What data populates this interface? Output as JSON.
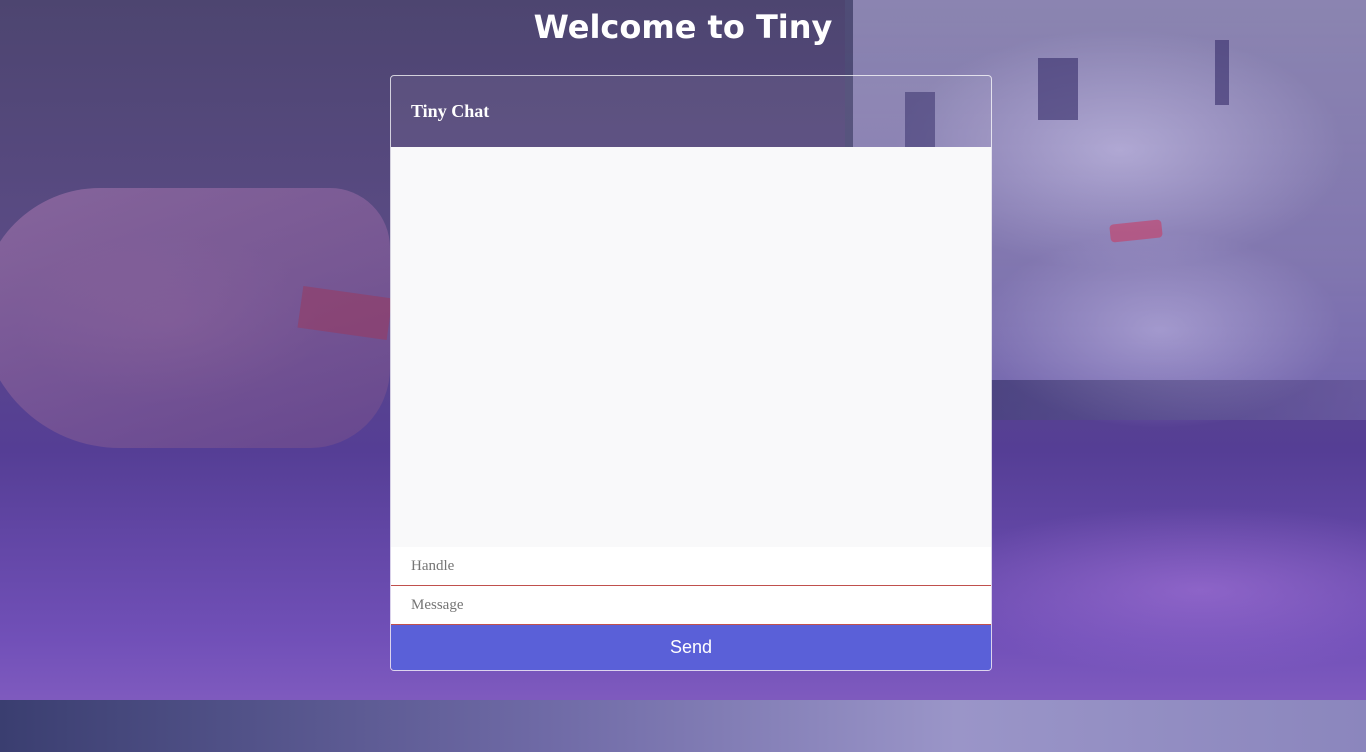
{
  "page": {
    "title": "Welcome to Tiny"
  },
  "chat": {
    "header_title": "Tiny Chat",
    "handle_input": {
      "value": "",
      "placeholder": "Handle"
    },
    "message_input": {
      "value": "",
      "placeholder": "Message"
    },
    "send_label": "Send"
  },
  "colors": {
    "send_button": "#5a60d8",
    "input_underline": "#c0504d",
    "chat_window_bg": "#f9f9fa",
    "overlay_purple": "#553e95"
  }
}
